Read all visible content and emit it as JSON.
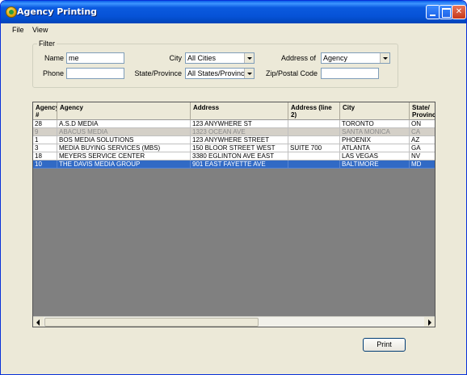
{
  "window": {
    "title": "Agency Printing"
  },
  "menu": {
    "items": [
      "File",
      "View"
    ]
  },
  "filter": {
    "legend": "Filter",
    "name_label": "Name",
    "name_value": "me",
    "phone_label": "Phone",
    "phone_value": "",
    "city_label": "City",
    "city_value": "All Cities",
    "state_label": "State/Province",
    "state_value": "All States/Provinces",
    "address_of_label": "Address of",
    "address_of_value": "Agency",
    "zip_label": "Zip/Postal Code",
    "zip_value": ""
  },
  "grid": {
    "headers": [
      "Agency #",
      "Agency",
      "Address",
      "Address (line 2)",
      "City",
      "State/ Province"
    ],
    "rows": [
      [
        "28",
        "A.S.D MEDIA",
        "123 ANYWHERE ST",
        "",
        "TORONTO",
        "ON"
      ],
      [
        "9",
        "ABACUS MEDIA",
        "1323 OCEAN AVE",
        "",
        "SANTA MONICA",
        "CA"
      ],
      [
        "1",
        "BOS MEDIA SOLUTIONS",
        "123 ANYWHERE STREET",
        "",
        "PHOENIX",
        "AZ"
      ],
      [
        "3",
        "MEDIA BUYING SERVICES (MBS)",
        "150 BLOOR STREET WEST",
        "SUITE 700",
        "ATLANTA",
        "GA"
      ],
      [
        "18",
        "MEYERS SERVICE CENTER",
        "3380 EGLINTON AVE EAST",
        "",
        "LAS VEGAS",
        "NV"
      ],
      [
        "10",
        "THE DAVIS MEDIA GROUP",
        "901 EAST FAYETTE AVE",
        "",
        "BALTIMORE",
        "MD"
      ]
    ],
    "row_states": [
      "normal",
      "alt",
      "normal",
      "normal",
      "normal",
      "selected"
    ]
  },
  "actions": {
    "print_label": "Print"
  }
}
